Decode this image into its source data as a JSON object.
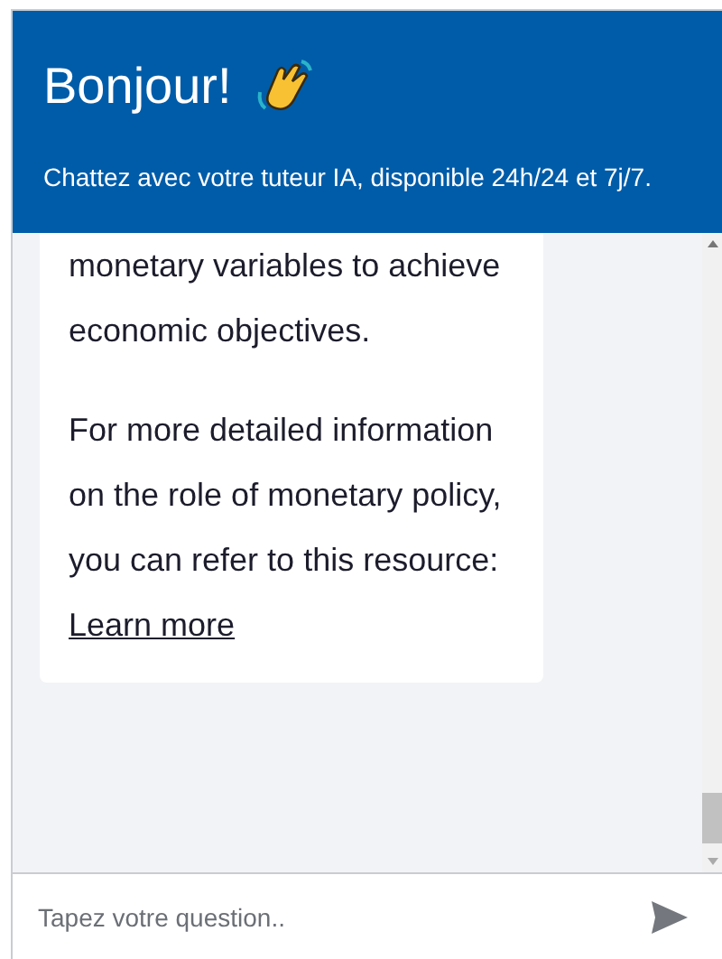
{
  "header": {
    "title": "Bonjour!",
    "subtitle": "Chattez avec votre tuteur IA, disponible 24h/24 et 7j/7."
  },
  "messages": [
    {
      "paragraphs": [
        {
          "text": "monetary variables to achieve economic objectives."
        },
        {
          "text": "For more detailed information on the role of monetary policy, you can refer to this resource: ",
          "link": "Learn more"
        }
      ]
    }
  ],
  "composer": {
    "placeholder": "Tapez votre question.."
  }
}
